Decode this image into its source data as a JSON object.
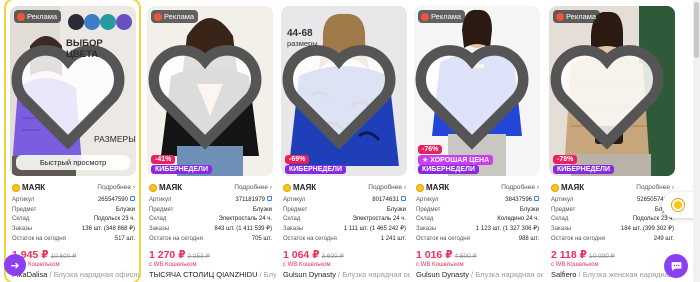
{
  "colors": {
    "accent": "#8a3ff2",
    "price": "#f0305a",
    "highlight": "#f7d33d"
  },
  "labels": {
    "ad": "Реклама",
    "more": "Подробнее",
    "brand_badge": "МАЯК",
    "article": "Артикул",
    "subject": "Предмет",
    "warehouse": "Склад",
    "orders": "Заказы",
    "stock": "Остаток на сегодня",
    "wallet": "с WB Кошельком",
    "quick_view": "Быстрый просмотр",
    "kiber": "КИБЕРНЕДЕЛИ",
    "good_price": "ХОРОШАЯ ЦЕНА"
  },
  "products": [
    {
      "photo_text_top": "ВЫБОР ЦВЕТА",
      "photo_text_bottom": "РАЗМЕРЫ",
      "article": "265547590",
      "subject": "Блузки",
      "warehouse": "Подольск",
      "warehouse_time": "23 ч.",
      "orders": "136 шт. (348 868 ₽)",
      "stock": "517 шт.",
      "price": "1 945 ₽",
      "old_price": "10 600 ₽",
      "brand": "PikaDalisa",
      "name": "Блузка нарядная офисная"
    },
    {
      "discount": "-41%",
      "article": "371181979",
      "subject": "Блузки",
      "warehouse": "Электросталь",
      "warehouse_time": "24 ч.",
      "orders": "843 шт. (1 411 539 ₽)",
      "stock": "705 шт.",
      "price": "1 270 ₽",
      "old_price": "2 253 ₽",
      "brand": "ТЫСЯЧА СТОЛИЦ QIANZHIDU",
      "name": "Блузка нарядная офисная"
    },
    {
      "photo_text_top": "44-68",
      "photo_text_bottom": "размеры",
      "discount": "-69%",
      "article": "80174631",
      "subject": "Блузки",
      "warehouse": "Электросталь",
      "warehouse_time": "24 ч.",
      "orders": "1 111 шт. (1 465 242 ₽)",
      "stock": "1 241 шт.",
      "price": "1 064 ₽",
      "old_price": "3 600 ₽",
      "brand": "Gulsun Dynasty",
      "name": "Блузка нарядная офисная"
    },
    {
      "discount": "-76%",
      "article": "38437596",
      "subject": "Блузки",
      "warehouse": "Коледино",
      "warehouse_time": "24 ч.",
      "orders": "1 123 шт. (1 327 306 ₽)",
      "stock": "988 шт.",
      "price": "1 016 ₽",
      "old_price": "4 500 ₽",
      "brand": "Gulsun Dynasty",
      "name": "Блузка нарядная офисная"
    },
    {
      "discount": "-78%",
      "article": "526505741",
      "subject": "Блузки",
      "warehouse": "Подольск",
      "warehouse_time": "23 ч.",
      "orders": "184 шт. (399 302 ₽)",
      "stock": "249 шт.",
      "price": "2 118 ₽",
      "old_price": "10 000 ₽",
      "brand": "Salfiero",
      "name": "Блузка женская нарядная офисная"
    }
  ]
}
